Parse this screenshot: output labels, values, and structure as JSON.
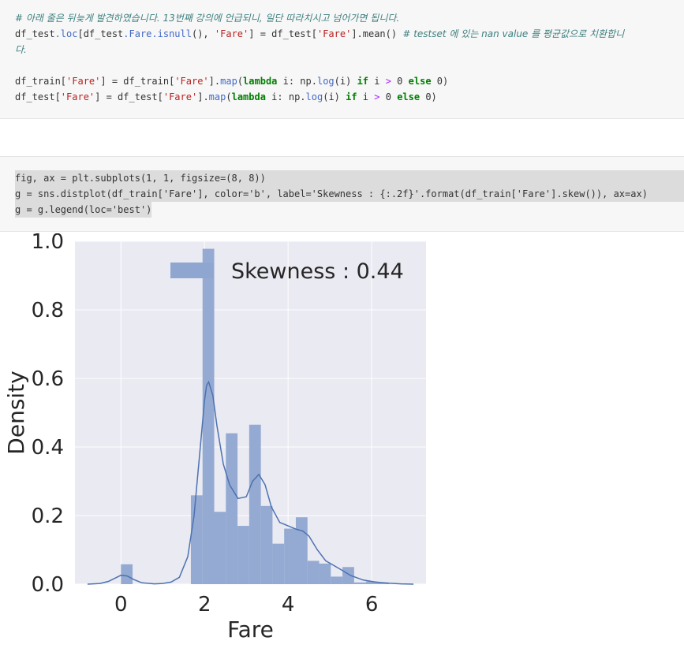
{
  "cell1": {
    "comment1": "# 아래 줄은 뒤늦게 발견하였습니다. 13번째 강의에 언급되니, 일단 따라치시고 넘어가면 됩니다.",
    "line2_a": "df_test",
    "line2_b": ".loc",
    "line2_c": "[df_test",
    "line2_d": ".Fare",
    "line2_e": ".isnull",
    "line2_f": "(), ",
    "line2_g": "'Fare'",
    "line2_h": "] = df_test[",
    "line2_i": "'Fare'",
    "line2_j": "].mean() ",
    "line2_comment": "# testset 에 있는 nan value 를 평균값으로 치환합니",
    "line2_comment_wrap": "다.",
    "line4": "df_train['Fare'] = df_train['Fare'].map(lambda i: np.log(i) if i > 0 else 0)",
    "line5": "df_test['Fare'] = df_test['Fare'].map(lambda i: np.log(i) if i > 0 else 0)"
  },
  "cell2": {
    "line1": "fig, ax = plt.subplots(1, 1, figsize=(8, 8))",
    "line2": "g = sns.distplot(df_train['Fare'], color='b', label='Skewness : {:.2f}'.format(df_train['Fare'].skew()), ax=ax)",
    "line3": "g = g.legend(loc='best')"
  },
  "chart_data": {
    "type": "bar",
    "subtype": "histogram-with-kde",
    "xlabel": "Fare",
    "ylabel": "Density",
    "xlim": [
      -1.1,
      7.3
    ],
    "ylim": [
      0,
      1.0
    ],
    "xticks": [
      "0",
      "2",
      "4",
      "6"
    ],
    "yticks": [
      "0.0",
      "0.2",
      "0.4",
      "0.6",
      "0.8",
      "1.0"
    ],
    "legend": "Skewness : 0.44",
    "legend_position": "upper-right",
    "grid": true,
    "colors": {
      "bar": "#8fa7d0",
      "line": "#4c72b0",
      "background": "#eaeaf2"
    },
    "bin_width": 0.279,
    "bins": [
      {
        "x0": 0.0,
        "value": 0.058
      },
      {
        "x0": 1.674,
        "value": 0.259
      },
      {
        "x0": 1.953,
        "value": 0.978
      },
      {
        "x0": 2.232,
        "value": 0.211
      },
      {
        "x0": 2.511,
        "value": 0.44
      },
      {
        "x0": 2.79,
        "value": 0.17
      },
      {
        "x0": 3.069,
        "value": 0.465
      },
      {
        "x0": 3.348,
        "value": 0.228
      },
      {
        "x0": 3.627,
        "value": 0.118
      },
      {
        "x0": 3.906,
        "value": 0.162
      },
      {
        "x0": 4.185,
        "value": 0.195
      },
      {
        "x0": 4.464,
        "value": 0.068
      },
      {
        "x0": 4.743,
        "value": 0.06
      },
      {
        "x0": 5.022,
        "value": 0.022
      },
      {
        "x0": 5.301,
        "value": 0.05
      },
      {
        "x0": 5.58,
        "value": 0.005
      },
      {
        "x0": 5.859,
        "value": 0.008
      },
      {
        "x0": 6.138,
        "value": 0.005
      }
    ],
    "kde": {
      "x": [
        -0.8,
        -0.5,
        -0.3,
        -0.1,
        0.0,
        0.15,
        0.3,
        0.5,
        0.8,
        1.0,
        1.2,
        1.4,
        1.6,
        1.75,
        1.9,
        2.0,
        2.05,
        2.1,
        2.2,
        2.3,
        2.45,
        2.6,
        2.8,
        3.0,
        3.15,
        3.3,
        3.45,
        3.6,
        3.8,
        4.0,
        4.2,
        4.35,
        4.5,
        4.7,
        4.9,
        5.1,
        5.3,
        5.5,
        5.8,
        6.1,
        6.4,
        6.7,
        7.0
      ],
      "y": [
        0.0,
        0.002,
        0.008,
        0.02,
        0.026,
        0.024,
        0.014,
        0.004,
        0.001,
        0.002,
        0.006,
        0.02,
        0.08,
        0.2,
        0.4,
        0.535,
        0.58,
        0.59,
        0.55,
        0.46,
        0.35,
        0.29,
        0.25,
        0.255,
        0.3,
        0.32,
        0.29,
        0.225,
        0.18,
        0.17,
        0.16,
        0.155,
        0.14,
        0.1,
        0.068,
        0.054,
        0.04,
        0.025,
        0.012,
        0.006,
        0.003,
        0.001,
        0.0
      ]
    }
  }
}
